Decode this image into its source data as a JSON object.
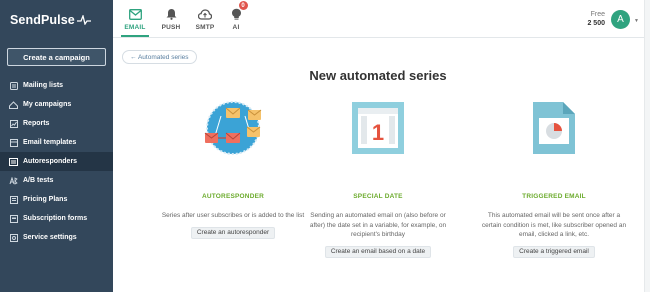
{
  "sidebar": {
    "logo": "SendPulse",
    "create_campaign": "Create a campaign",
    "items": [
      {
        "label": "Mailing lists",
        "icon": "list-icon"
      },
      {
        "label": "My campaigns",
        "icon": "campaigns-icon"
      },
      {
        "label": "Reports",
        "icon": "reports-icon"
      },
      {
        "label": "Email templates",
        "icon": "template-icon"
      },
      {
        "label": "Autoresponders",
        "icon": "autoresponder-icon",
        "active": true
      },
      {
        "label": "A/B tests",
        "icon": "ab-test-icon"
      },
      {
        "label": "Pricing Plans",
        "icon": "pricing-icon"
      },
      {
        "label": "Subscription forms",
        "icon": "form-icon"
      },
      {
        "label": "Service settings",
        "icon": "settings-icon"
      }
    ]
  },
  "topbar": {
    "tabs": [
      {
        "label": "EMAIL",
        "icon": "email-icon",
        "active": true
      },
      {
        "label": "PUSH",
        "icon": "push-icon"
      },
      {
        "label": "SMTP",
        "icon": "cloud-icon"
      },
      {
        "label": "AI",
        "icon": "ai-icon",
        "badge": "0"
      }
    ],
    "plan_name": "Free",
    "plan_count": "2 500",
    "avatar_initial": "A"
  },
  "main": {
    "back_label": "← Automated series",
    "title": "New automated series",
    "cards": [
      {
        "title": "AUTORESPONDER",
        "description": "Series after user subscribes or is added to the list",
        "button": "Create an autoresponder",
        "icon": "autoresponder-illustration"
      },
      {
        "title": "SPECIAL DATE",
        "description": "Sending an automated email on (also before or after) the date set in a variable, for example, on recipient's birthday",
        "button": "Create an email based on a date",
        "icon": "calendar-illustration",
        "calendar_day": "1"
      },
      {
        "title": "TRIGGERED EMAIL",
        "description": "This automated email will be sent once after a certain condition is met, like subscriber opened an email, clicked a link, etc.",
        "button": "Create a triggered email",
        "icon": "chart-document-illustration"
      }
    ]
  },
  "colors": {
    "sidebar_bg": "#33475b",
    "sidebar_active": "#243546",
    "accent_green": "#2fa37f",
    "card_title_green": "#6cab2d",
    "badge_red": "#e0554d"
  }
}
